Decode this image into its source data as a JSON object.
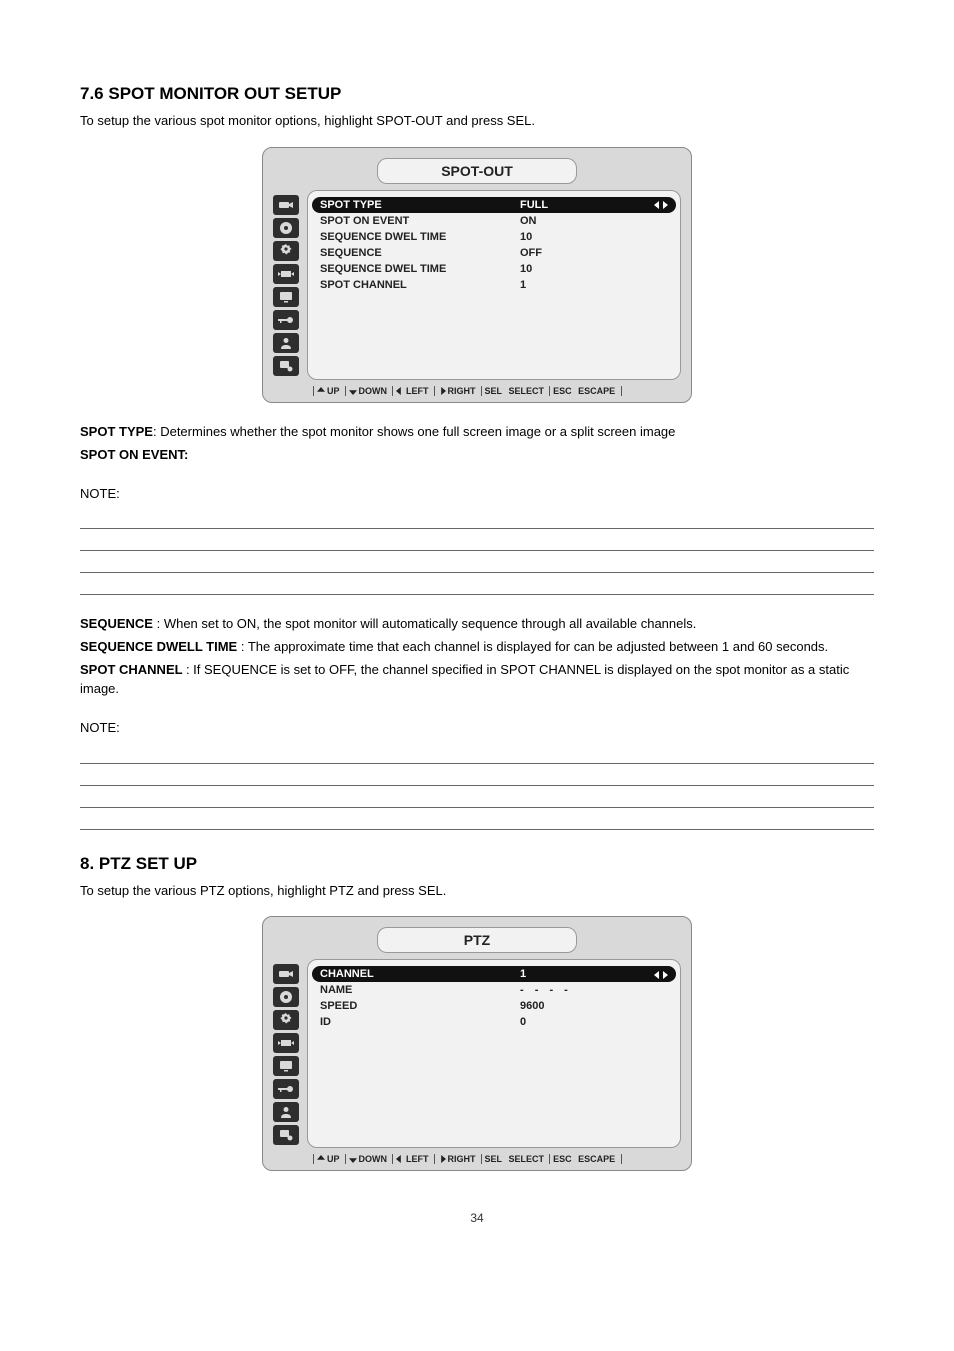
{
  "page_number": "34",
  "spotout": {
    "section_title": "7.6 SPOT MONITOR OUT SETUP",
    "intro": "To setup the various spot monitor options, highlight SPOT-OUT and press SEL.",
    "panel_title": "SPOT-OUT",
    "rows": [
      {
        "label": "SPOT TYPE",
        "value": "FULL",
        "selected": true
      },
      {
        "label": "SPOT ON EVENT",
        "value": "ON"
      },
      {
        "label": "SEQUENCE DWEL TIME",
        "value": "10"
      },
      {
        "label": "SEQUENCE",
        "value": "OFF"
      },
      {
        "label": "SEQUENCE DWEL TIME",
        "value": "10"
      },
      {
        "label": "SPOT CHANNEL",
        "value": "1"
      }
    ],
    "desc": [
      "SPOT TYPE: Determines whether the spot monitor shows one full screen image or a split screen image",
      "SPOT ON EVENT:",
      "SEQUENCE : When set to ON, the spot monitor will automatically sequence through all available channels.",
      "SEQUENCE DWELL TIME : The approximate time that each channel is displayed for can be adjusted between 1 and 60 seconds.",
      "SPOT CHANNEL : If SEQUENCE is set to OFF, the channel specified in SPOT CHANNEL is displayed on the spot monitor as a static image."
    ],
    "notes_label": "NOTE:"
  },
  "ptz": {
    "section_title": "8. PTZ SET UP",
    "intro": "To setup the various PTZ options, highlight PTZ and press SEL.",
    "panel_title": "PTZ",
    "rows": [
      {
        "label": "CHANNEL",
        "value": "1",
        "selected": true
      },
      {
        "label": "NAME",
        "value": "- - - -",
        "dashes": true
      },
      {
        "label": "SPEED",
        "value": "9600"
      },
      {
        "label": "ID",
        "value": "0"
      }
    ]
  },
  "help": {
    "up": "UP",
    "down": "DOWN",
    "left": "LEFT",
    "right": "RIGHT",
    "sel_k": "SEL",
    "sel_l": "SELECT",
    "esc_k": "ESC",
    "esc_l": "ESCAPE"
  }
}
